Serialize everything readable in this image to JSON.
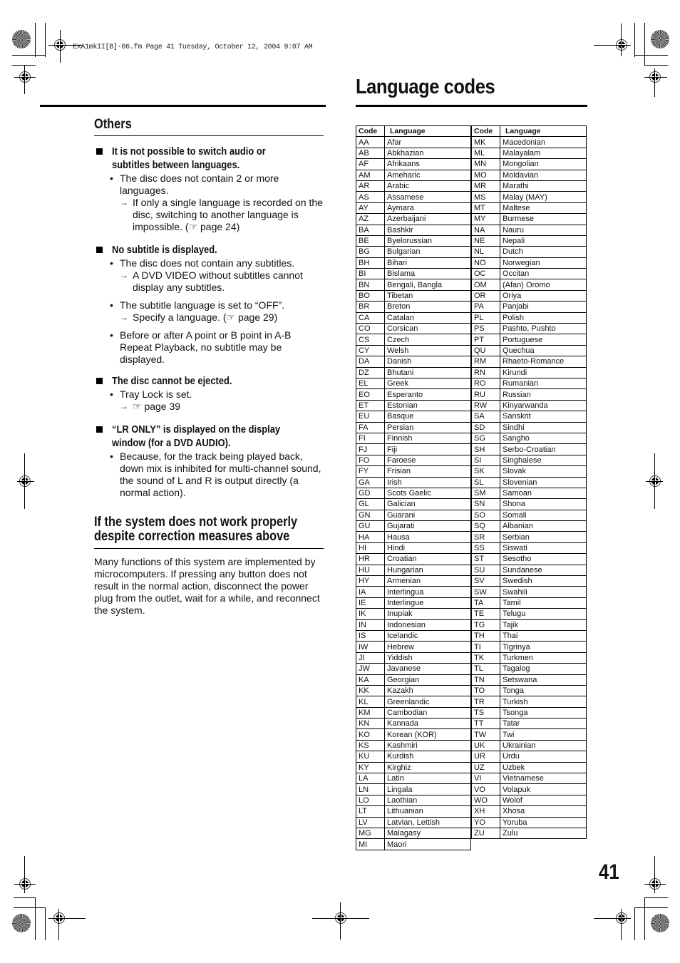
{
  "header_meta": "EXA1mkII[B]-06.fm  Page 41  Tuesday, October 12, 2004  9:07 AM",
  "page_title": "Language codes",
  "page_number": "41",
  "left": {
    "section_title": "Others",
    "items": [
      {
        "heading": "It is not possible to switch audio or subtitles between languages.",
        "bullets": [
          {
            "text": "The disc does not contain 2 or more languages.",
            "arrows": [
              "If only a single language is recorded on the disc, switching to another language is impossible. (☞ page 24)"
            ]
          }
        ]
      },
      {
        "heading": "No subtitle is displayed.",
        "bullets": [
          {
            "text": "The disc does not contain any subtitles.",
            "arrows": [
              "A DVD VIDEO without subtitles cannot display any subtitles."
            ]
          },
          {
            "text": "The subtitle language is set to “OFF”.",
            "arrows": [
              "Specify a language. (☞ page 29)"
            ]
          },
          {
            "text": "Before or after A point or B point in A-B Repeat Playback, no subtitle may be displayed.",
            "arrows": []
          }
        ]
      },
      {
        "heading": "The disc cannot be ejected.",
        "bullets": [
          {
            "text": "Tray Lock is set.",
            "arrows": [
              "☞ page 39"
            ]
          }
        ]
      },
      {
        "heading": "“LR ONLY” is displayed on the display window (for a DVD AUDIO).",
        "bullets": [
          {
            "text": "Because, for the track being played back, down mix is inhibited for multi-channel sound, the sound of L and R is output directly (a normal action).",
            "arrows": []
          }
        ]
      }
    ],
    "section2_title": "If the system does not work properly despite correction measures above",
    "section2_text": "Many functions of this system are implemented by microcomputers. If pressing any button does not result in the normal action, disconnect the power plug from the outlet, wait for a while, and reconnect the system."
  },
  "table": {
    "headers": {
      "code": "Code",
      "language": "Language"
    },
    "left_rows": [
      [
        "AA",
        "Afar"
      ],
      [
        "AB",
        "Abkhazian"
      ],
      [
        "AF",
        "Afrikaans"
      ],
      [
        "AM",
        "Ameharic"
      ],
      [
        "AR",
        "Arabic"
      ],
      [
        "AS",
        "Assamese"
      ],
      [
        "AY",
        "Aymara"
      ],
      [
        "AZ",
        "Azerbaijani"
      ],
      [
        "BA",
        "Bashkir"
      ],
      [
        "BE",
        "Byelorussian"
      ],
      [
        "BG",
        "Bulgarian"
      ],
      [
        "BH",
        "Bihari"
      ],
      [
        "BI",
        "Bislama"
      ],
      [
        "BN",
        "Bengali, Bangla"
      ],
      [
        "BO",
        "Tibetan"
      ],
      [
        "BR",
        "Breton"
      ],
      [
        "CA",
        "Catalan"
      ],
      [
        "CO",
        "Corsican"
      ],
      [
        "CS",
        "Czech"
      ],
      [
        "CY",
        "Welsh"
      ],
      [
        "DA",
        "Danish"
      ],
      [
        "DZ",
        "Bhutani"
      ],
      [
        "EL",
        "Greek"
      ],
      [
        "EO",
        "Esperanto"
      ],
      [
        "ET",
        "Estonian"
      ],
      [
        "EU",
        "Basque"
      ],
      [
        "FA",
        "Persian"
      ],
      [
        "FI",
        "Finnish"
      ],
      [
        "FJ",
        "Fiji"
      ],
      [
        "FO",
        "Faroese"
      ],
      [
        "FY",
        "Frisian"
      ],
      [
        "GA",
        "Irish"
      ],
      [
        "GD",
        "Scots Gaelic"
      ],
      [
        "GL",
        "Galician"
      ],
      [
        "GN",
        "Guarani"
      ],
      [
        "GU",
        "Gujarati"
      ],
      [
        "HA",
        "Hausa"
      ],
      [
        "HI",
        "Hindi"
      ],
      [
        "HR",
        "Croatian"
      ],
      [
        "HU",
        "Hungarian"
      ],
      [
        "HY",
        "Armenian"
      ],
      [
        "IA",
        "Interlingua"
      ],
      [
        "IE",
        "Interlingue"
      ],
      [
        "IK",
        "Inupiak"
      ],
      [
        "IN",
        "Indonesian"
      ],
      [
        "IS",
        "Icelandic"
      ],
      [
        "IW",
        "Hebrew"
      ],
      [
        "JI",
        "Yiddish"
      ],
      [
        "JW",
        "Javanese"
      ],
      [
        "KA",
        "Georgian"
      ],
      [
        "KK",
        "Kazakh"
      ],
      [
        "KL",
        "Greenlandic"
      ],
      [
        "KM",
        "Cambodian"
      ],
      [
        "KN",
        "Kannada"
      ],
      [
        "KO",
        "Korean (KOR)"
      ],
      [
        "KS",
        "Kashmiri"
      ],
      [
        "KU",
        "Kurdish"
      ],
      [
        "KY",
        "Kirghiz"
      ],
      [
        "LA",
        "Latin"
      ],
      [
        "LN",
        "Lingala"
      ],
      [
        "LO",
        "Laothian"
      ],
      [
        "LT",
        "Lithuanian"
      ],
      [
        "LV",
        "Latvian, Lettish"
      ],
      [
        "MG",
        "Malagasy"
      ],
      [
        "MI",
        "Maori"
      ]
    ],
    "right_rows": [
      [
        "MK",
        "Macedonian"
      ],
      [
        "ML",
        "Malayalam"
      ],
      [
        "MN",
        "Mongolian"
      ],
      [
        "MO",
        "Moldavian"
      ],
      [
        "MR",
        "Marathi"
      ],
      [
        "MS",
        "Malay (MAY)"
      ],
      [
        "MT",
        "Maltese"
      ],
      [
        "MY",
        "Burmese"
      ],
      [
        "NA",
        "Nauru"
      ],
      [
        "NE",
        "Nepali"
      ],
      [
        "NL",
        "Dutch"
      ],
      [
        "NO",
        "Norwegian"
      ],
      [
        "OC",
        "Occitan"
      ],
      [
        "OM",
        "(Afan) Oromo"
      ],
      [
        "OR",
        "Oriya"
      ],
      [
        "PA",
        "Panjabi"
      ],
      [
        "PL",
        "Polish"
      ],
      [
        "PS",
        "Pashto, Pushto"
      ],
      [
        "PT",
        "Portuguese"
      ],
      [
        "QU",
        "Quechua"
      ],
      [
        "RM",
        "Rhaeto-Romance"
      ],
      [
        "RN",
        "Kirundi"
      ],
      [
        "RO",
        "Rumanian"
      ],
      [
        "RU",
        "Russian"
      ],
      [
        "RW",
        "Kinyarwanda"
      ],
      [
        "SA",
        "Sanskrit"
      ],
      [
        "SD",
        "Sindhi"
      ],
      [
        "SG",
        "Sangho"
      ],
      [
        "SH",
        "Serbo-Croatian"
      ],
      [
        "SI",
        "Singhalese"
      ],
      [
        "SK",
        "Slovak"
      ],
      [
        "SL",
        "Slovenian"
      ],
      [
        "SM",
        "Samoan"
      ],
      [
        "SN",
        "Shona"
      ],
      [
        "SO",
        "Somali"
      ],
      [
        "SQ",
        "Albanian"
      ],
      [
        "SR",
        "Serbian"
      ],
      [
        "SS",
        "Siswati"
      ],
      [
        "ST",
        "Sesotho"
      ],
      [
        "SU",
        "Sundanese"
      ],
      [
        "SV",
        "Swedish"
      ],
      [
        "SW",
        "Swahili"
      ],
      [
        "TA",
        "Tamil"
      ],
      [
        "TE",
        "Telugu"
      ],
      [
        "TG",
        "Tajik"
      ],
      [
        "TH",
        "Thai"
      ],
      [
        "TI",
        "Tigrinya"
      ],
      [
        "TK",
        "Turkmen"
      ],
      [
        "TL",
        "Tagalog"
      ],
      [
        "TN",
        "Setswana"
      ],
      [
        "TO",
        "Tonga"
      ],
      [
        "TR",
        "Turkish"
      ],
      [
        "TS",
        "Tsonga"
      ],
      [
        "TT",
        "Tatar"
      ],
      [
        "TW",
        "Twi"
      ],
      [
        "UK",
        "Ukrainian"
      ],
      [
        "UR",
        "Urdu"
      ],
      [
        "UZ",
        "Uzbek"
      ],
      [
        "VI",
        "Vietnamese"
      ],
      [
        "VO",
        "Volapuk"
      ],
      [
        "WO",
        "Wolof"
      ],
      [
        "XH",
        "Xhosa"
      ],
      [
        "YO",
        "Yoruba"
      ],
      [
        "ZU",
        "Zulu"
      ]
    ]
  }
}
